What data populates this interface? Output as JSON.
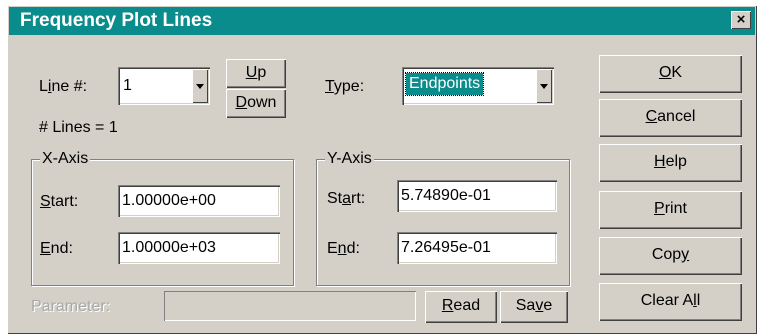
{
  "window": {
    "title": "Frequency Plot Lines",
    "close_glyph": "×"
  },
  "line": {
    "label_pre": "L",
    "label_u": "i",
    "label_post": "ne #:",
    "value": "1",
    "count_text": "# Lines = 1"
  },
  "type": {
    "label_u": "T",
    "label_post": "ype:",
    "value": "Endpoints"
  },
  "buttons": {
    "up": {
      "u": "U",
      "post": "p"
    },
    "down": {
      "u": "D",
      "post": "own"
    },
    "ok": {
      "u": "O",
      "post": "K"
    },
    "cancel": {
      "u": "C",
      "post": "ancel"
    },
    "help": {
      "u": "H",
      "post": "elp"
    },
    "print": {
      "u": "P",
      "post": "rint"
    },
    "copy": {
      "pre": "Cop",
      "u": "y"
    },
    "clear_all": {
      "pre": "Clear A",
      "u": "l",
      "post": "l"
    },
    "read": {
      "u": "R",
      "post": "ead"
    },
    "save": {
      "pre": "Sa",
      "u": "v",
      "post": "e"
    }
  },
  "x_axis": {
    "title": "X-Axis",
    "start_u": "S",
    "start_post": "tart:",
    "end_u": "E",
    "end_post": "nd:",
    "start_value": "1.00000e+00",
    "end_value": "1.00000e+03"
  },
  "y_axis": {
    "title": "Y-Axis",
    "start_pre": "St",
    "start_u": "a",
    "start_post": "rt:",
    "end_pre": "E",
    "end_u": "n",
    "end_post": "d:",
    "start_value": "5.74890e-01",
    "end_value": "7.26495e-01"
  },
  "parameter": {
    "label": "Parameter:",
    "value": ""
  }
}
